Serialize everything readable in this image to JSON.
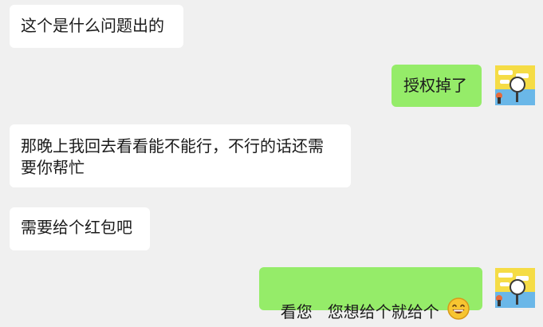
{
  "messages": [
    {
      "side": "in",
      "text": "这个是什么问题出的"
    },
    {
      "side": "out",
      "text": "授权掉了"
    },
    {
      "side": "in",
      "lines": [
        "那晚上我回去看看能不能行，不行的话还需",
        "要你帮忙"
      ]
    },
    {
      "side": "in",
      "text": "需要给个红包吧"
    },
    {
      "side": "out",
      "text": "看您   您想给个就给个",
      "emoji": "grinning-face-emoji"
    }
  ],
  "colors": {
    "background": "#f0f0f0",
    "incoming_bubble": "#ffffff",
    "outgoing_bubble": "#95ec69"
  },
  "avatar": {
    "icon": "magnifier-cartoon-avatar"
  }
}
